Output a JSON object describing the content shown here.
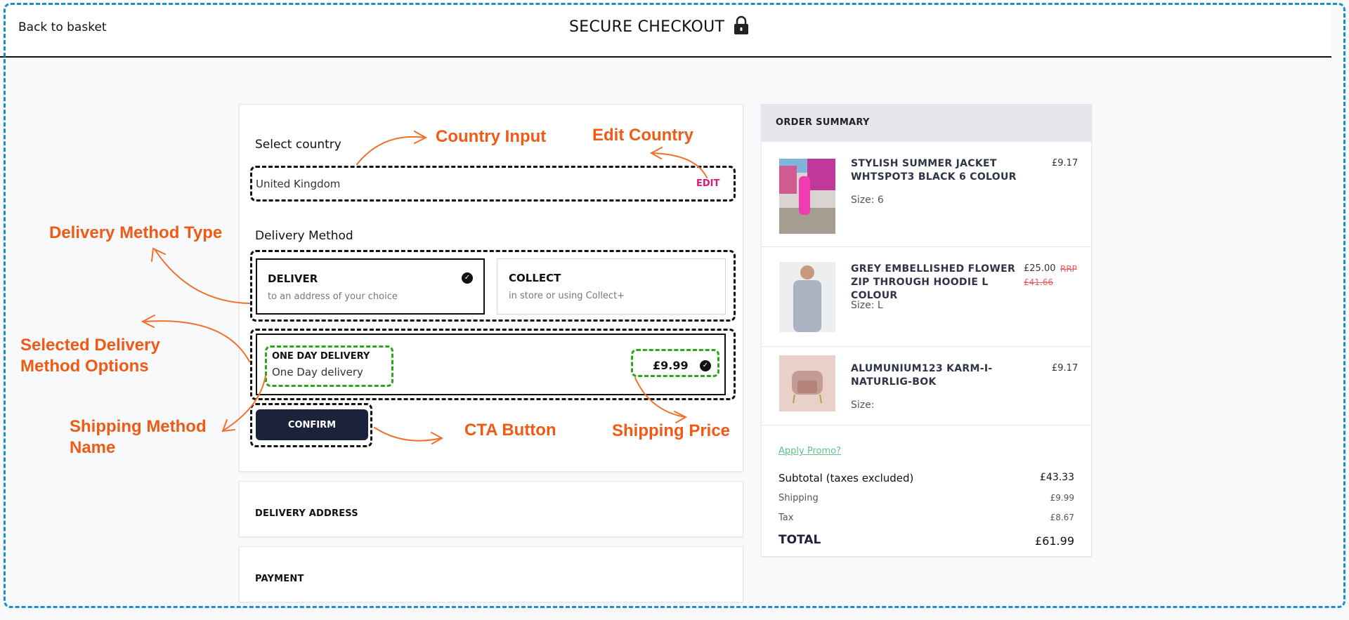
{
  "header": {
    "back_link": "Back to basket",
    "title": "SECURE CHECKOUT",
    "title_icon": "lock-icon"
  },
  "checkout": {
    "country": {
      "label": "Select country",
      "value": "United Kingdom",
      "edit_label": "EDIT"
    },
    "delivery_method": {
      "label": "Delivery Method",
      "options": [
        {
          "title": "DELIVER",
          "subtitle": "to an address of your choice",
          "selected": true
        },
        {
          "title": "COLLECT",
          "subtitle": "in store or using Collect+",
          "selected": false
        }
      ]
    },
    "shipping_option": {
      "title": "ONE DAY DELIVERY",
      "subtitle": "One Day delivery",
      "price": "£9.99",
      "selected": true
    },
    "confirm_label": "CONFIRM",
    "sections": [
      "DELIVERY ADDRESS",
      "PAYMENT"
    ]
  },
  "order_summary": {
    "title": "ORDER SUMMARY",
    "items": [
      {
        "name": "STYLISH SUMMER JACKET WHTSPOT3 BLACK 6 COLOUR",
        "price": "£9.17",
        "rrp_label": "",
        "rrp": "",
        "size": "Size: 6",
        "image": "pink-dress-photo"
      },
      {
        "name": "GREY EMBELLISHED FLOWER ZIP THROUGH HOODIE L COLOUR",
        "price": "£25.00",
        "rrp_label": "RRP",
        "rrp": "£41.66",
        "size": "Size: L",
        "image": "grey-hoodie-photo"
      },
      {
        "name": "ALUMUNIUM123 KARM-I-NATURLIG-BOK",
        "price": "£9.17",
        "rrp_label": "",
        "rrp": "",
        "size": "Size:",
        "image": "pink-armchair-photo"
      }
    ],
    "promo_link": "Apply Promo?",
    "subtotal": {
      "label": "Subtotal (taxes excluded)",
      "value": "£43.33"
    },
    "shipping": {
      "label": "Shipping",
      "value": "£9.99"
    },
    "tax": {
      "label": "Tax",
      "value": "£8.67"
    },
    "total": {
      "label": "TOTAL",
      "value": "£61.99"
    }
  },
  "annotations": {
    "country_input": "Country Input",
    "edit_country": "Edit Country",
    "delivery_method_type": "Delivery Method Type",
    "selected_delivery_options": "Selected Delivery Method Options",
    "shipping_method_name": "Shipping Method Name",
    "cta_button": "CTA Button",
    "shipping_price": "Shipping Price"
  },
  "colors": {
    "accent_edit": "#e0147c",
    "cta_bg": "#1a233a",
    "promo_link": "#5fc48c",
    "rrp_strike": "#e66060",
    "annotation": "#f05a14",
    "highlight_green": "#2aa81a",
    "frame_blue": "#1a8fc5"
  }
}
